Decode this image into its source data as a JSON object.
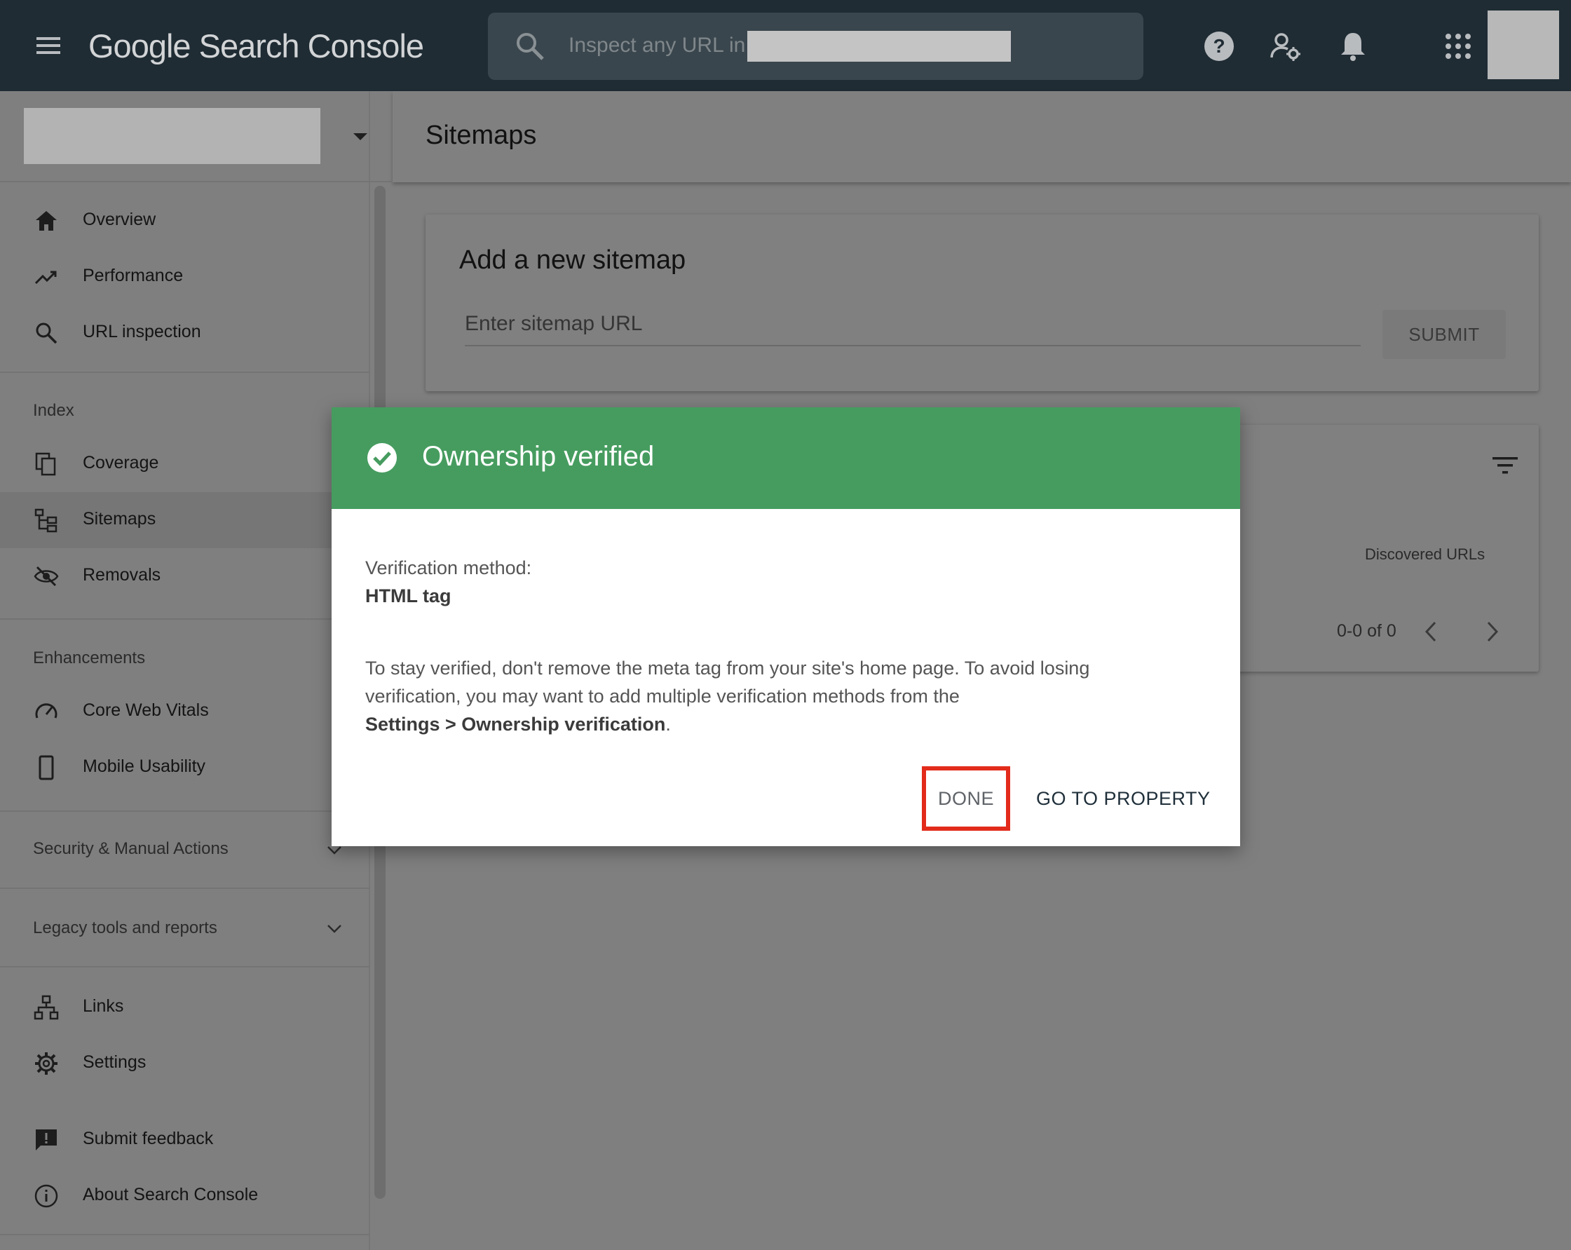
{
  "topbar": {
    "logo": "Google Search Console",
    "search_placeholder": "Inspect any URL in"
  },
  "sidebar": {
    "items": [
      {
        "label": "Overview",
        "icon": "home-icon"
      },
      {
        "label": "Performance",
        "icon": "trending-up-icon"
      },
      {
        "label": "URL inspection",
        "icon": "search-icon"
      }
    ],
    "index_section": "Index",
    "index_items": [
      {
        "label": "Coverage",
        "icon": "copy-icon"
      },
      {
        "label": "Sitemaps",
        "icon": "sitemap-icon"
      },
      {
        "label": "Removals",
        "icon": "eye-off-icon"
      }
    ],
    "enhancements_section": "Enhancements",
    "enhancement_items": [
      {
        "label": "Core Web Vitals",
        "icon": "gauge-icon"
      },
      {
        "label": "Mobile Usability",
        "icon": "phone-icon"
      }
    ],
    "security_section": "Security & Manual Actions",
    "legacy_section": "Legacy tools and reports",
    "other_items": [
      {
        "label": "Links",
        "icon": "links-icon"
      },
      {
        "label": "Settings",
        "icon": "gear-icon"
      }
    ],
    "footer_items": [
      {
        "label": "Submit feedback",
        "icon": "feedback-icon"
      },
      {
        "label": "About Search Console",
        "icon": "info-icon"
      }
    ]
  },
  "main": {
    "page_title": "Sitemaps",
    "add_card": {
      "title": "Add a new sitemap",
      "input_placeholder": "Enter sitemap URL",
      "submit_label": "SUBMIT"
    },
    "table_card": {
      "column_header": "Discovered URLs",
      "pagination": "0-0 of 0"
    }
  },
  "dialog": {
    "title": "Ownership verified",
    "method_label": "Verification method:",
    "method_value": "HTML tag",
    "body_line1": "To stay verified, don't remove the meta tag from your site's home page. To avoid losing",
    "body_line2": "verification, you may want to add multiple verification methods from the",
    "body_bold": "Settings > Ownership verification",
    "body_end": ".",
    "done_label": "DONE",
    "goto_label": "GO TO PROPERTY"
  },
  "colors": {
    "topbar_bg": "#1f2c34",
    "dialog_header": "#469c5f",
    "highlight_border": "#e32b1b"
  }
}
